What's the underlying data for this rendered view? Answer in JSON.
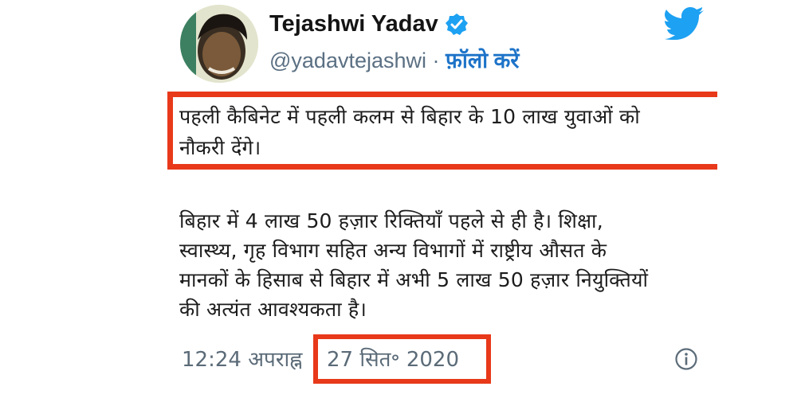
{
  "author": {
    "name": "Tejashwi Yadav",
    "handle": "@yadavtejashwi",
    "separator": " · ",
    "follow_label": "फ़ॉलो करें",
    "verified_icon": "verified-badge-icon"
  },
  "tweet": {
    "highlight_lines": [
      "पहली कैबिनेट में पहली कलम से बिहार के 10 लाख युवाओं को",
      "नौकरी देंगे।"
    ],
    "body_lines": [
      "बिहार में 4 लाख 50 हज़ार रिक्तियाँ पहले से ही है। शिक्षा,",
      "स्वास्थ्य, गृह विभाग सहित अन्य विभागों में राष्ट्रीय औसत के",
      "मानकों के हिसाब से बिहार में अभी 5 लाख 50 हज़ार नियुक्तियों",
      "की अत्यंत आवश्यकता है।"
    ]
  },
  "meta": {
    "time": "12:24 अपराह्न",
    "date": "27 सित॰ 2020"
  },
  "colors": {
    "highlight": "#e8391a",
    "twitter_blue": "#1da1f2",
    "link": "#1d73c8"
  }
}
